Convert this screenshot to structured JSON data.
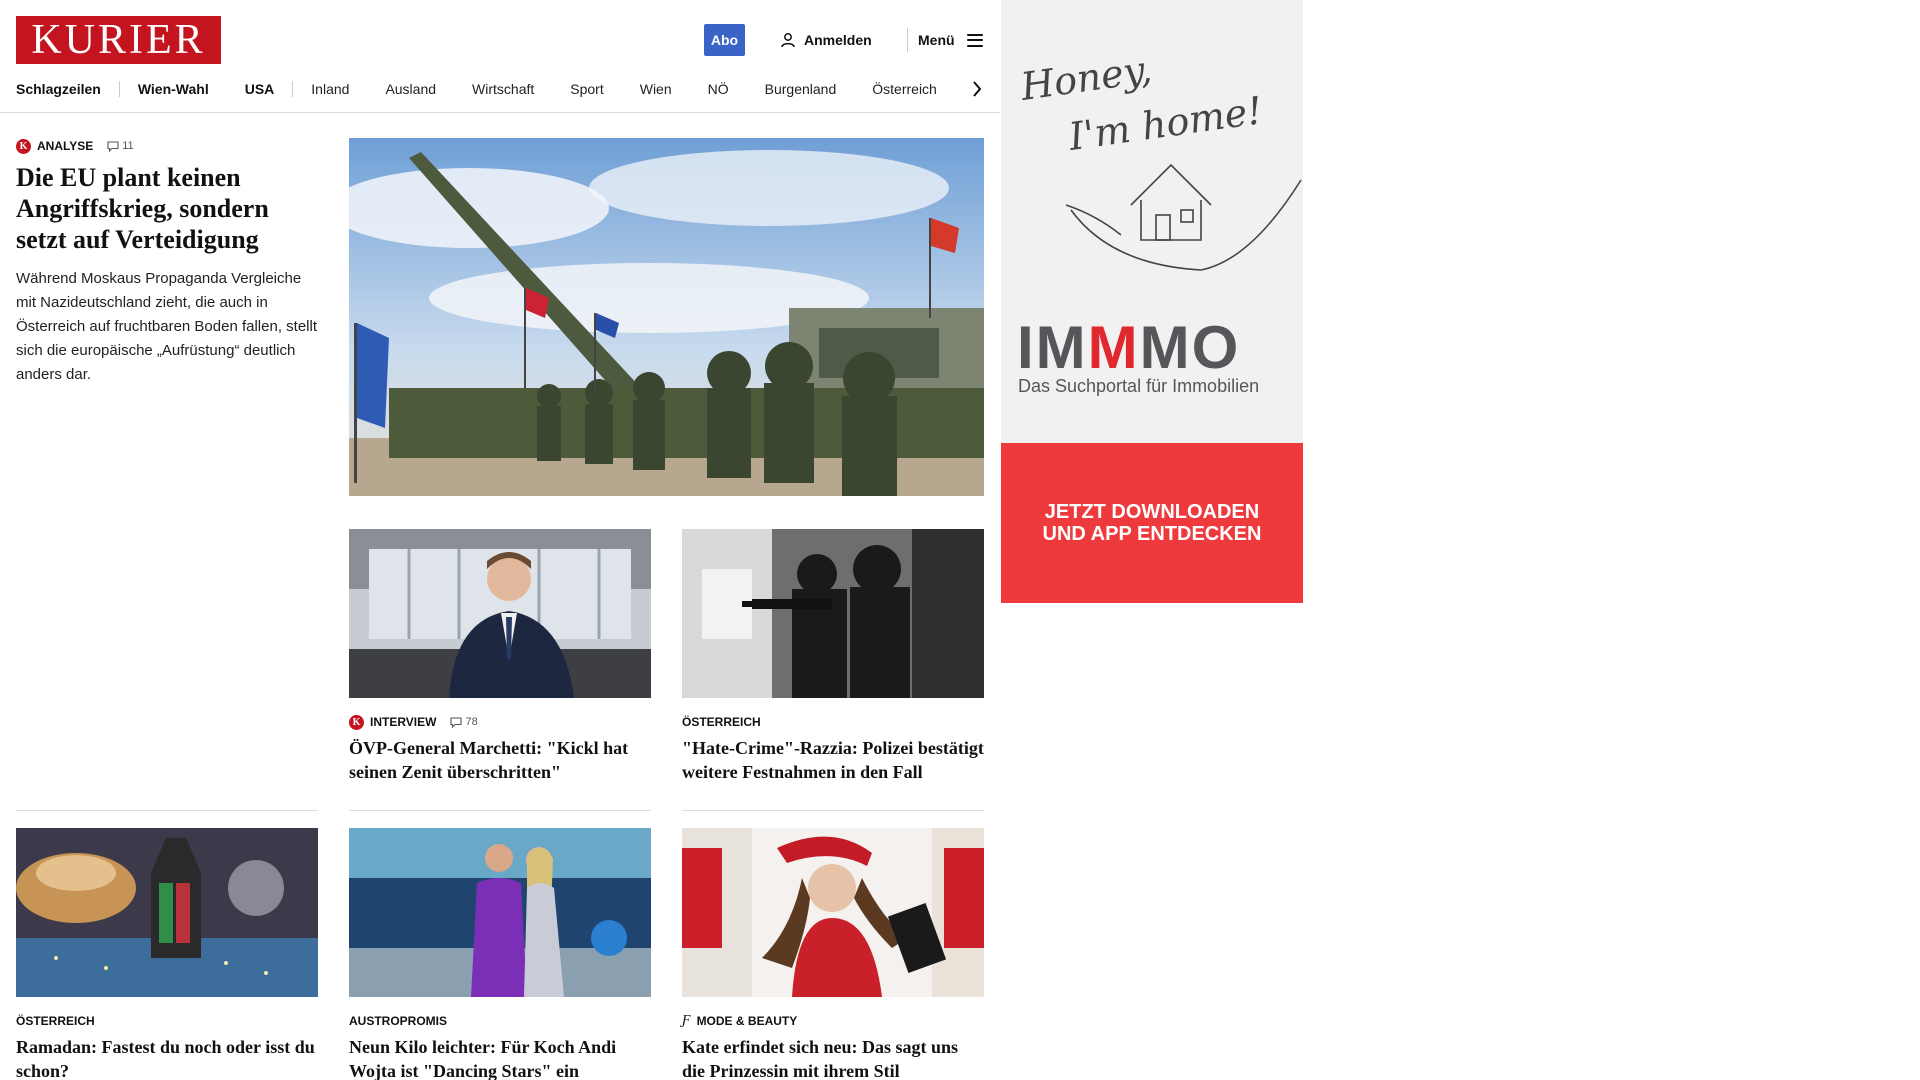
{
  "header": {
    "logo_text": "KURIER",
    "abo_label": "Abo",
    "login_label": "Anmelden",
    "menu_label": "Menü"
  },
  "nav": {
    "items": [
      "Schlagzeilen",
      "Wien-Wahl",
      "USA",
      "Inland",
      "Ausland",
      "Wirtschaft",
      "Sport",
      "Wien",
      "NÖ",
      "Burgenland",
      "Österreich"
    ]
  },
  "lead": {
    "kicker": "ANALYSE",
    "comments": "11",
    "title": "Die EU plant keinen Angriffskrieg, sondern setzt auf Verteidigung",
    "teaser": "Während Moskaus Propaganda Vergleiche mit Nazideutschland zieht, die auch in Österreich auf fruchtbaren Boden fallen, stellt sich die europäische „Aufrüstung“ deutlich anders dar."
  },
  "cards": [
    {
      "kicker": "INTERVIEW",
      "comments": "78",
      "title": "ÖVP-General Marchetti: \"Kickl hat seinen Zenit überschritten\""
    },
    {
      "kicker": "ÖSTERREICH",
      "title": "\"Hate-Crime\"-Razzia: Polizei bestätigt weitere Festnahmen in den Fall"
    },
    {
      "kicker": "ÖSTERREICH",
      "title": "Ramadan: Fastest du noch oder isst du schon?"
    },
    {
      "kicker": "AUSTROPROMIS",
      "title": "Neun Kilo leichter: Für Koch Andi Wojta ist \"Dancing Stars\" ein \"Gamechanger\""
    },
    {
      "kicker": "MODE & BEAUTY",
      "title": "Kate erfindet sich neu: Das sagt uns die Prinzessin mit ihrem Stil"
    }
  ],
  "ad": {
    "script_line1": "Honey,",
    "script_line2": "I'm home!",
    "brand_pre": "IM",
    "brand_m": "M",
    "brand_post": "MO",
    "tagline": "Das Suchportal für Immobilien",
    "cta": "JETZT DOWNLOADEN\nUND APP ENTDECKEN"
  },
  "colors": {
    "brand_red": "#c4141f",
    "abo_blue": "#3a64c8",
    "ad_red": "#ee3a3d"
  }
}
